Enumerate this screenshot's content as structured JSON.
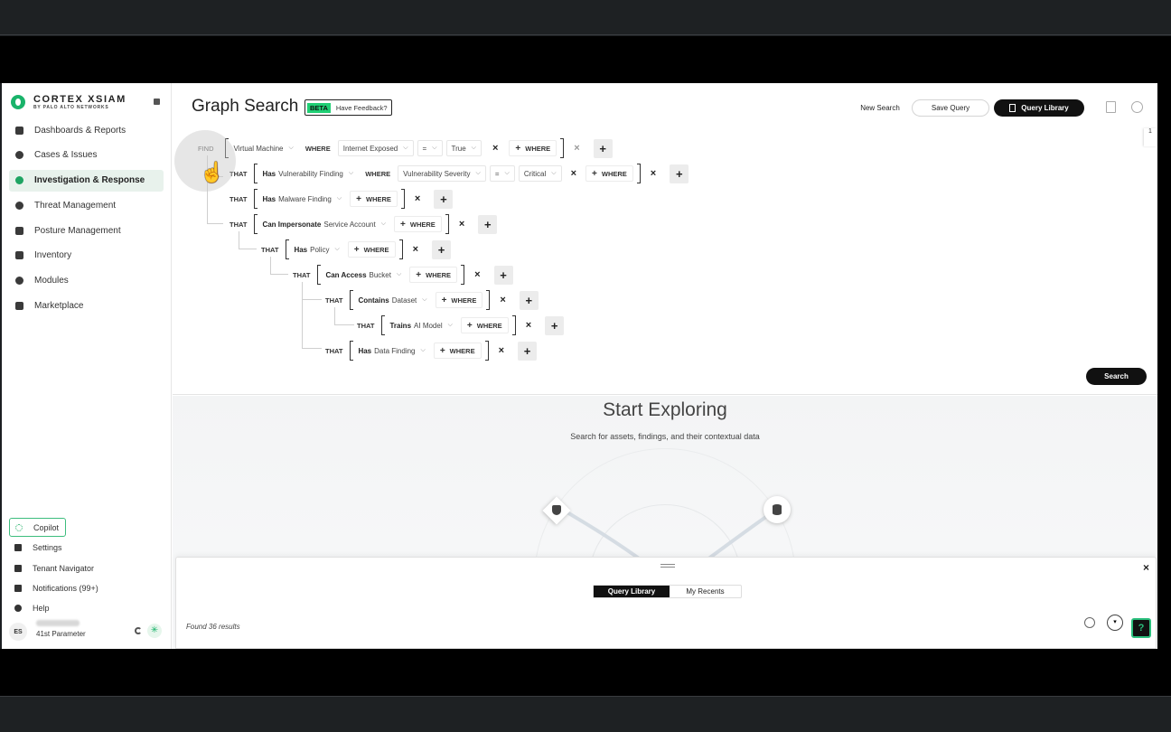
{
  "brand": {
    "title": "CORTEX XSIAM",
    "subtitle": "BY PALO ALTO NETWORKS"
  },
  "sidebar": {
    "items": [
      {
        "label": "Dashboards & Reports",
        "icon": "dashboard-icon"
      },
      {
        "label": "Cases & Issues",
        "icon": "shield-icon"
      },
      {
        "label": "Investigation & Response",
        "icon": "eye-icon",
        "active": true
      },
      {
        "label": "Threat Management",
        "icon": "target-icon"
      },
      {
        "label": "Posture Management",
        "icon": "clipboard-icon"
      },
      {
        "label": "Inventory",
        "icon": "boxes-icon"
      },
      {
        "label": "Modules",
        "icon": "modules-icon"
      },
      {
        "label": "Marketplace",
        "icon": "store-icon"
      }
    ],
    "bottom": [
      {
        "label": "Copilot",
        "icon": "copilot-icon"
      },
      {
        "label": "Settings",
        "icon": "gear-icon"
      },
      {
        "label": "Tenant Navigator",
        "icon": "grid-icon"
      },
      {
        "label": "Notifications (99+)",
        "icon": "bell-icon"
      },
      {
        "label": "Help",
        "icon": "help-icon"
      }
    ],
    "user": {
      "initials": "ES",
      "tenant": "41st Parameter"
    }
  },
  "header": {
    "title": "Graph Search",
    "beta": "BETA",
    "feedback": "Have Feedback?",
    "new_search": "New Search",
    "save_query": "Save Query",
    "query_library": "Query Library"
  },
  "query": {
    "find": "FIND",
    "that": "THAT",
    "where": "WHERE",
    "add_where": "WHERE",
    "root": {
      "entity": "Virtual Machine",
      "field": "Internet Exposed",
      "op": "=",
      "value": "True"
    },
    "rows": [
      {
        "verb": "Has",
        "object": "Vulnerability Finding",
        "field": "Vulnerability Severity",
        "op": "=",
        "value": "Critical"
      },
      {
        "verb": "Has",
        "object": "Malware Finding"
      },
      {
        "verb": "Can Impersonate",
        "object": "Service Account"
      },
      {
        "verb": "Has",
        "object": "Policy"
      },
      {
        "verb": "Can Access",
        "object": "Bucket"
      },
      {
        "verb": "Contains",
        "object": "Dataset"
      },
      {
        "verb": "Trains",
        "object": "AI Model"
      },
      {
        "verb": "Has",
        "object": "Data Finding"
      }
    ],
    "search_label": "Search",
    "scroll_indicator": "1"
  },
  "explore": {
    "title": "Start Exploring",
    "subtitle": "Search for assets, findings, and their contextual data"
  },
  "drawer": {
    "tabs": [
      "Query Library",
      "My Recents"
    ],
    "results": "Found 36 results",
    "sort_label": "▾",
    "help_label": "?"
  }
}
